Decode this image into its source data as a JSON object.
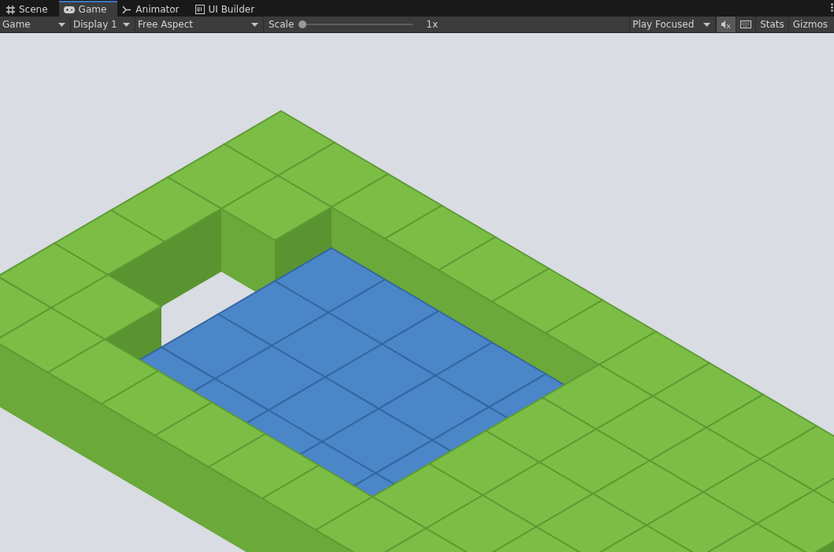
{
  "tabs": [
    {
      "label": "Scene",
      "selected": false
    },
    {
      "label": "Game",
      "selected": true
    },
    {
      "label": "Animator",
      "selected": false
    },
    {
      "label": "UI Builder",
      "selected": false
    }
  ],
  "toolbar": {
    "view_dropdown": "Game",
    "display_dropdown": "Display 1",
    "aspect_dropdown": "Free Aspect",
    "scale": {
      "label": "Scale",
      "level": 0,
      "reading": "1x"
    },
    "play_mode_dropdown": "Play Focused",
    "mute_audio": {
      "on": true
    },
    "stats_button": "Stats",
    "gizmos_button": "Gizmos"
  }
}
